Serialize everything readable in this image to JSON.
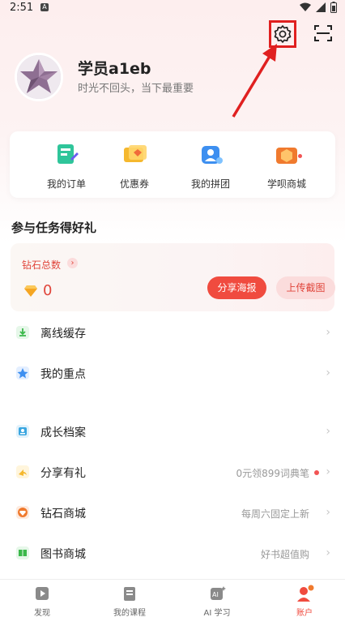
{
  "status_bar": {
    "time": "2:51"
  },
  "profile": {
    "username": "学员a1eb",
    "motto": "时光不回头，当下最重要"
  },
  "quick_actions": [
    {
      "label": "我的订单",
      "icon": "order-icon"
    },
    {
      "label": "优惠券",
      "icon": "coupon-icon"
    },
    {
      "label": "我的拼团",
      "icon": "group-buy-icon"
    },
    {
      "label": "学呗商城",
      "icon": "store-icon",
      "badge_dot": true
    }
  ],
  "tasks": {
    "title": "参与任务得好礼",
    "diamond_label": "钻石总数",
    "diamond_count": "0",
    "share_button": "分享海报",
    "upload_button": "上传截图"
  },
  "menu": [
    {
      "label": "离线缓存",
      "note": "",
      "icon": "download-icon",
      "color": "#3ab84a"
    },
    {
      "label": "我的重点",
      "note": "",
      "icon": "star-icon",
      "color": "#3d8ff0"
    },
    {
      "label": "成长档案",
      "note": "",
      "icon": "profile-icon",
      "color": "#3aa6e0"
    },
    {
      "label": "分享有礼",
      "note": "0元领899词典笔",
      "icon": "share-icon",
      "color": "#f5b82e",
      "dot": true
    },
    {
      "label": "钻石商城",
      "note": "每周六固定上新",
      "icon": "diamond-icon",
      "color": "#f07a2e"
    },
    {
      "label": "图书商城",
      "note": "好书超值购",
      "icon": "book-icon",
      "color": "#3ab84a"
    }
  ],
  "tabbar": [
    {
      "label": "发现",
      "icon": "discover-icon"
    },
    {
      "label": "我的课程",
      "icon": "courses-icon"
    },
    {
      "label": "AI 学习",
      "icon": "ai-learning-icon"
    },
    {
      "label": "账户",
      "icon": "account-icon",
      "active": true
    }
  ],
  "colors": {
    "accent": "#f04b3f",
    "highlight_box": "#e02020"
  }
}
